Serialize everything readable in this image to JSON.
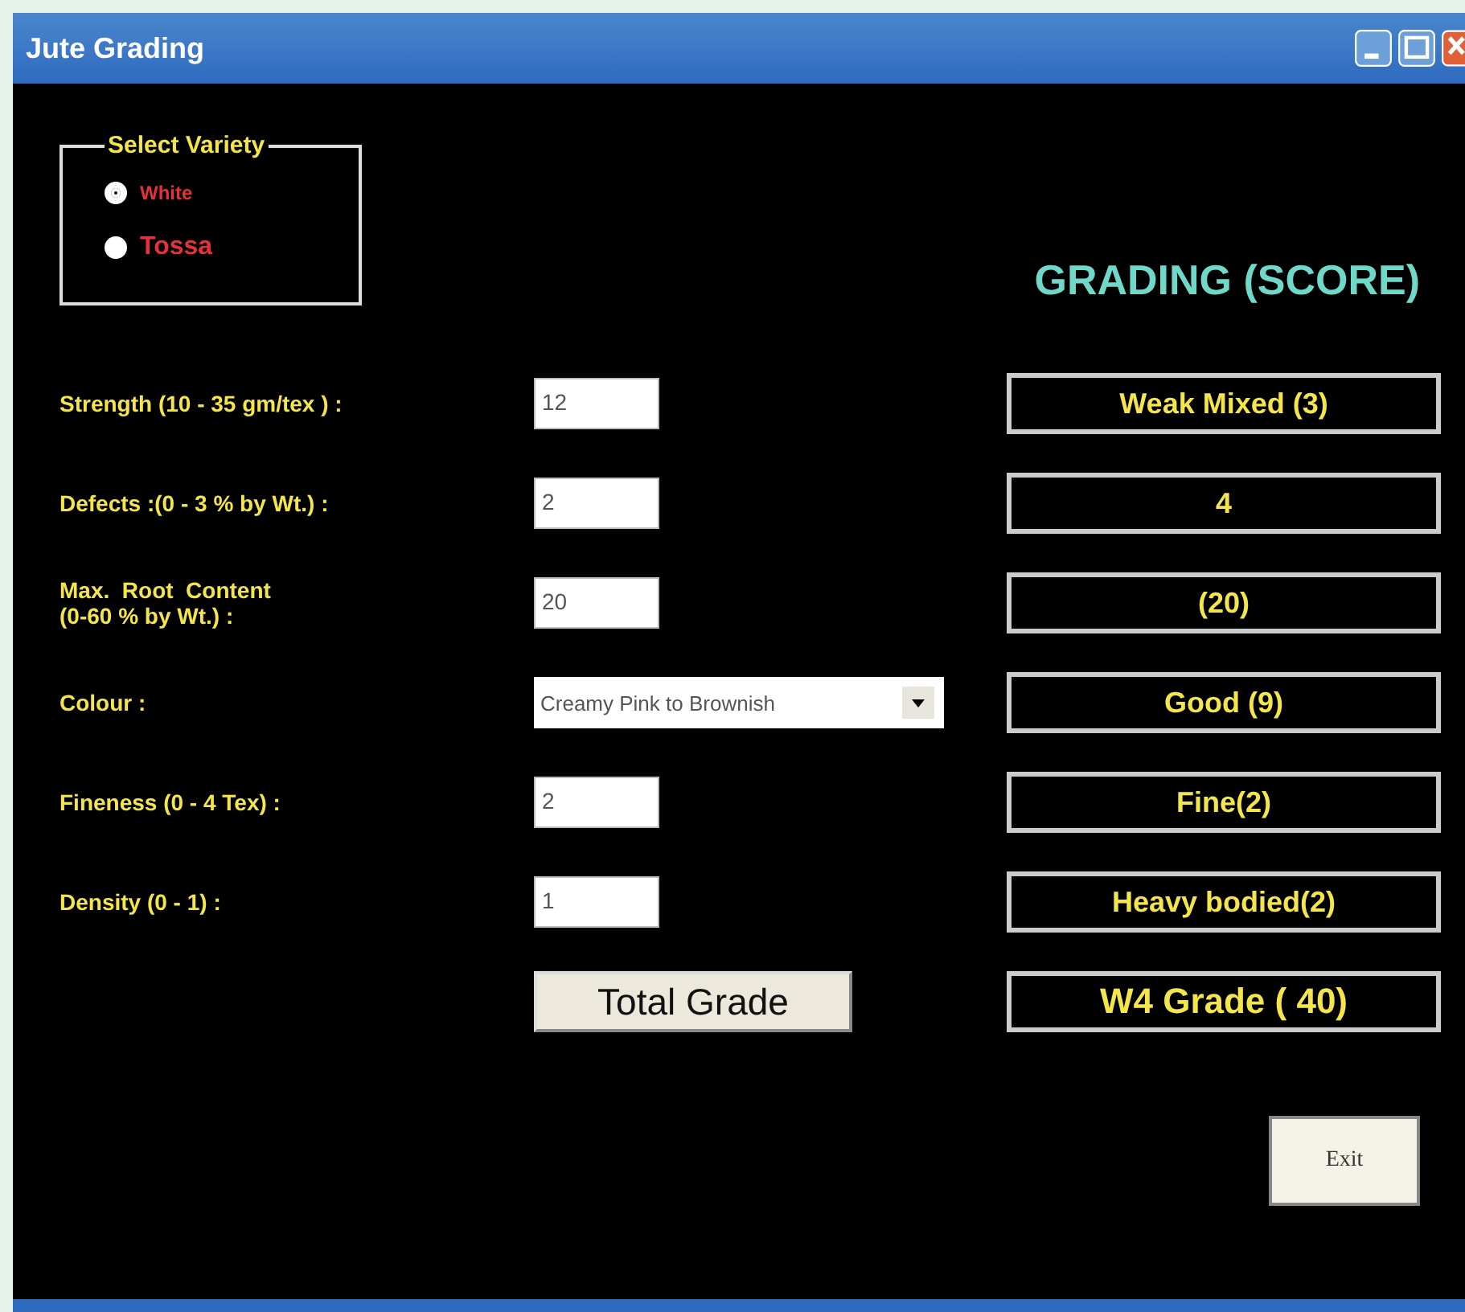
{
  "window": {
    "title": "Jute Grading"
  },
  "variety": {
    "legend": "Select Variety",
    "options": [
      {
        "label": "White",
        "selected": true
      },
      {
        "label": "Tossa",
        "selected": false
      }
    ]
  },
  "heading": "GRADING (SCORE)",
  "rows": [
    {
      "label": "Strength (10 - 35 gm/tex ) :",
      "kind": "text",
      "value": "12",
      "result": "Weak Mixed (3)"
    },
    {
      "label": "Defects :(0 - 3 % by Wt.) :",
      "kind": "text",
      "value": "2",
      "result": "4"
    },
    {
      "label": "Max.  Root  Content\n(0-60 % by Wt.) :",
      "kind": "text",
      "value": "20",
      "result": "(20)"
    },
    {
      "label": "Colour :",
      "kind": "dropdown",
      "value": "Creamy Pink to Brownish",
      "result": "Good (9)"
    },
    {
      "label": "Fineness (0 - 4 Tex) :",
      "kind": "text",
      "value": "2",
      "result": "Fine(2)"
    },
    {
      "label": "Density (0 - 1) :",
      "kind": "text",
      "value": "1",
      "result": "Heavy bodied(2)"
    }
  ],
  "total": {
    "button": "Total Grade",
    "result": "W4 Grade ( 40)"
  },
  "exit": "Exit"
}
